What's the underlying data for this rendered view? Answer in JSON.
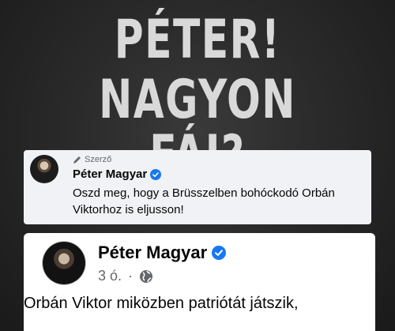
{
  "headline": {
    "line1": "PÉTER!",
    "line2": "NAGYON FÁJ?"
  },
  "comment": {
    "author_tag": "Szerző",
    "name": "Péter Magyar",
    "text": "Oszd meg, hogy a Brüsszelben bohóckodó Orbán Viktorhoz is eljusson!"
  },
  "post": {
    "name": "Péter Magyar",
    "time": "3 ó.",
    "separator": "·",
    "text": "Orbán Viktor miközben patriótát játszik,"
  },
  "colors": {
    "verified": "#1877f2",
    "headline": "#d9d9d9"
  },
  "icons": [
    "pencil-icon",
    "verified-badge-icon",
    "globe-icon"
  ]
}
